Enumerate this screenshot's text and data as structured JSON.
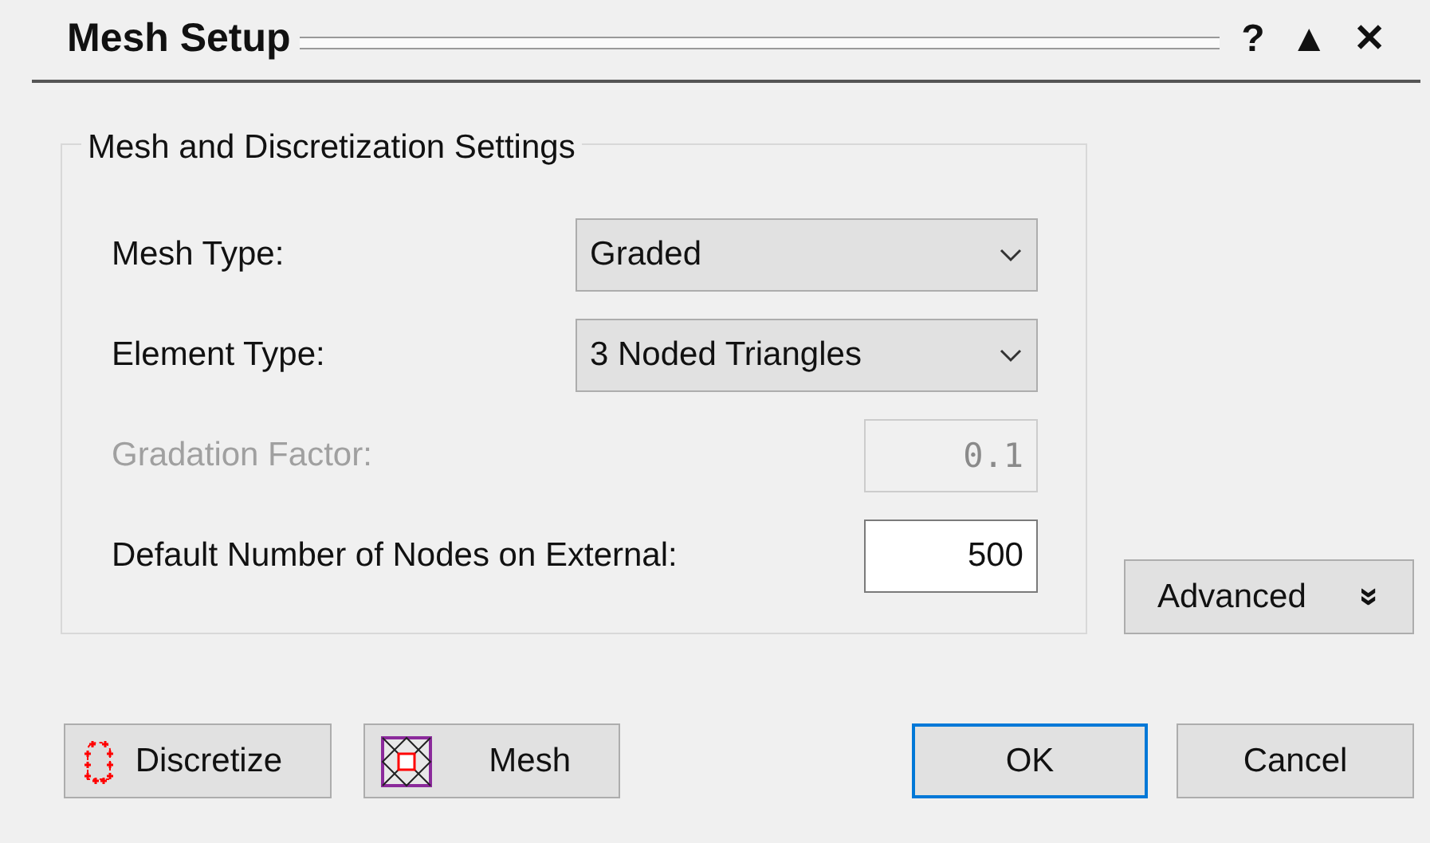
{
  "window": {
    "title": "Mesh Setup",
    "controls": [
      "?",
      "▲",
      "✕"
    ]
  },
  "group": {
    "title": "Mesh and Discretization Settings",
    "fields": [
      {
        "kind": "dropdown",
        "label": "Mesh Type:",
        "value": "Graded",
        "disabled": false
      },
      {
        "kind": "dropdown",
        "label": "Element Type:",
        "value": "3 Noded Triangles",
        "disabled": false
      },
      {
        "kind": "number",
        "label": "Gradation Factor:",
        "value": "0.1",
        "disabled": true
      },
      {
        "kind": "number",
        "label": "Default Number of Nodes on External:",
        "value": "500",
        "disabled": false
      }
    ]
  },
  "advanced_button": {
    "label": "Advanced",
    "expander": "»"
  },
  "buttons": [
    {
      "kind": "discretize",
      "label": "Discretize",
      "default": false
    },
    {
      "kind": "mesh",
      "label": "Mesh",
      "default": false
    },
    {
      "kind": "plain",
      "label": "OK",
      "default": true
    },
    {
      "kind": "plain",
      "label": "Cancel",
      "default": false
    }
  ]
}
